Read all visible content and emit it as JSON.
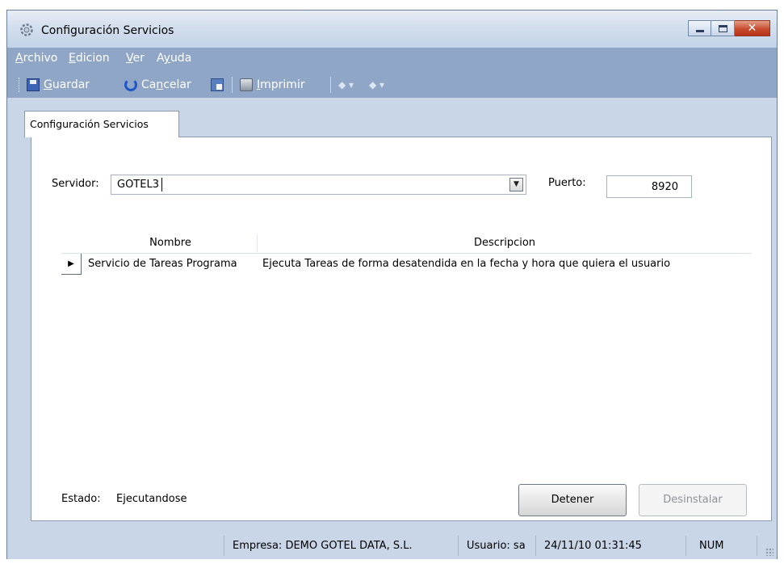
{
  "window": {
    "title": "Configuración Servicios",
    "controls": {
      "minimize": "minimize",
      "maximize": "maximize",
      "close": "close"
    }
  },
  "menu": {
    "archivo": {
      "accel": "A",
      "rest": "rchivo"
    },
    "edicion": {
      "accel": "E",
      "rest": "dicion"
    },
    "ver": {
      "accel": "V",
      "rest": "er"
    },
    "ayuda": {
      "pre": "A",
      "accel": "y",
      "rest": "uda"
    }
  },
  "toolbar": {
    "guardar": {
      "accel": "G",
      "rest": "uardar",
      "icon": "save-icon"
    },
    "cancelar": {
      "pre": "Ca",
      "accel": "n",
      "rest": "celar",
      "icon": "undo-icon"
    },
    "export_icon": "export-icon",
    "imprimir": {
      "accel": "I",
      "rest": "mprimir",
      "icon": "print-icon"
    },
    "nav_prev": "◆ ▾",
    "nav_next": "◆ ▾"
  },
  "tab": {
    "label": "Configuración Servicios"
  },
  "form": {
    "servidor_label": "Servidor:",
    "servidor_value": "GOTEL3",
    "puerto_label": "Puerto:",
    "puerto_value": "8920"
  },
  "grid": {
    "columns": [
      "Nombre",
      "Descripcion"
    ],
    "rows": [
      {
        "selector": "▶",
        "nombre": "Servicio de Tareas Programa",
        "descripcion": "Ejecuta Tareas de forma desatendida en la fecha y hora que quiera el usuario"
      }
    ]
  },
  "status": {
    "label": "Estado:",
    "value": "Ejecutandose"
  },
  "buttons": {
    "detener": "Detener",
    "desinstalar": "Desinstalar"
  },
  "statusbar": {
    "empresa": "Empresa: DEMO GOTEL DATA, S.L.",
    "usuario": "Usuario: sa",
    "fecha": "24/11/10 01:31:45",
    "num": "NUM"
  }
}
